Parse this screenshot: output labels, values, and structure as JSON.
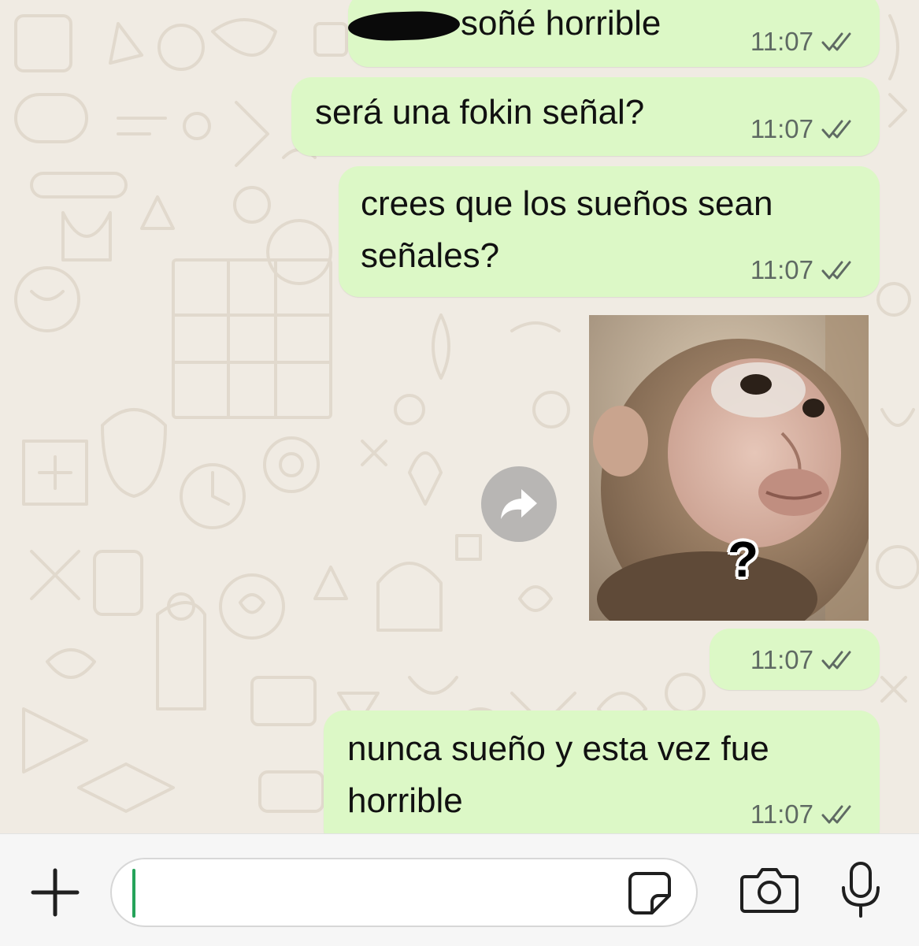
{
  "messages": [
    {
      "text": "soñé horrible",
      "time": "11:07",
      "redacted_prefix": true
    },
    {
      "text": "será una fokin señal?",
      "time": "11:07"
    },
    {
      "text": "crees que los sueños sean\nseñales?",
      "time": "11:07"
    },
    {
      "sticker": "monkey-question-sticker",
      "sticker_caption": "?",
      "time": "11:07"
    },
    {
      "text": "nunca sueño y esta vez fue\nhorrible",
      "time": "11:07"
    }
  ],
  "composer": {
    "value": "",
    "icons": [
      "plus-icon",
      "sticker-icon",
      "camera-icon",
      "microphone-icon"
    ]
  },
  "colors": {
    "outgoing_bubble": "#dcf8c6",
    "chat_background": "#f0ebe3",
    "caret": "#25a35a",
    "timestamp": "#5f6a63"
  }
}
